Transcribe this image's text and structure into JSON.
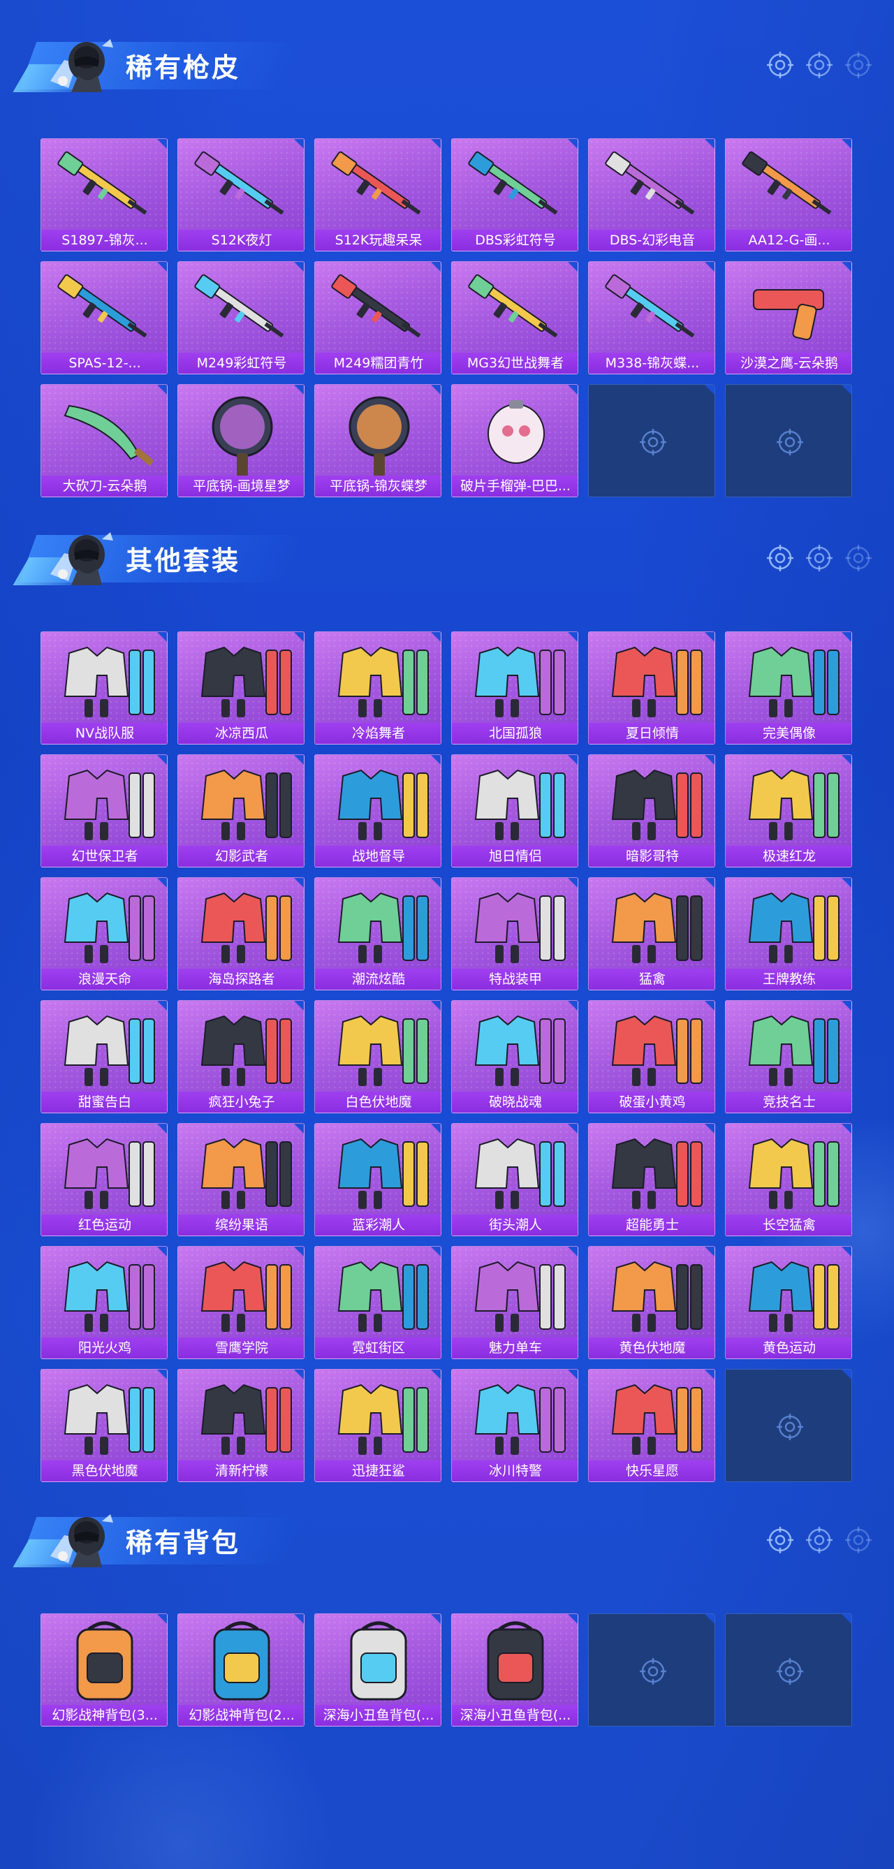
{
  "colors": {
    "background": "#1c4fd8",
    "card_purple": "#a65ae0",
    "label_bar": "#9133e8",
    "empty_slot": "#1e3d7d",
    "title_text": "#ffffff"
  },
  "sections": [
    {
      "title": "稀有枪皮",
      "items": [
        {
          "label": "S1897-锦灰...",
          "icon": "shotgun-icon"
        },
        {
          "label": "S12K夜灯",
          "icon": "shotgun-icon"
        },
        {
          "label": "S12K玩趣呆呆",
          "icon": "shotgun-icon"
        },
        {
          "label": "DBS彩虹符号",
          "icon": "shotgun-icon"
        },
        {
          "label": "DBS-幻彩电音",
          "icon": "shotgun-icon"
        },
        {
          "label": "AA12-G-画...",
          "icon": "rifle-icon"
        },
        {
          "label": "SPAS-12-...",
          "icon": "shotgun-icon"
        },
        {
          "label": "M249彩虹符号",
          "icon": "machine-gun-icon"
        },
        {
          "label": "M249糯团青竹",
          "icon": "machine-gun-icon"
        },
        {
          "label": "MG3幻世战舞者",
          "icon": "machine-gun-icon"
        },
        {
          "label": "M338-锦灰蝶...",
          "icon": "rifle-icon"
        },
        {
          "label": "沙漠之鹰-云朵鹅",
          "icon": "pistol-icon"
        },
        {
          "label": "大砍刀-云朵鹅",
          "icon": "machete-icon"
        },
        {
          "label": "平底锅-画境星梦",
          "icon": "pan-icon"
        },
        {
          "label": "平底锅-锦灰蝶梦",
          "icon": "pan-icon"
        },
        {
          "label": "破片手榴弹-巴巴...",
          "icon": "grenade-icon"
        }
      ],
      "empty_slots": 2
    },
    {
      "title": "其他套装",
      "items": [
        {
          "label": "NV战队服",
          "icon": "outfit-icon"
        },
        {
          "label": "冰凉西瓜",
          "icon": "outfit-icon"
        },
        {
          "label": "冷焰舞者",
          "icon": "outfit-icon"
        },
        {
          "label": "北国孤狼",
          "icon": "outfit-icon"
        },
        {
          "label": "夏日倾情",
          "icon": "outfit-icon"
        },
        {
          "label": "完美偶像",
          "icon": "outfit-icon"
        },
        {
          "label": "幻世保卫者",
          "icon": "outfit-icon"
        },
        {
          "label": "幻影武者",
          "icon": "outfit-icon"
        },
        {
          "label": "战地督导",
          "icon": "outfit-icon"
        },
        {
          "label": "旭日情侣",
          "icon": "outfit-icon"
        },
        {
          "label": "暗影哥特",
          "icon": "outfit-icon"
        },
        {
          "label": "极速红龙",
          "icon": "outfit-icon"
        },
        {
          "label": "浪漫天命",
          "icon": "outfit-icon"
        },
        {
          "label": "海岛探路者",
          "icon": "outfit-icon"
        },
        {
          "label": "潮流炫酷",
          "icon": "outfit-icon"
        },
        {
          "label": "特战装甲",
          "icon": "outfit-icon"
        },
        {
          "label": "猛禽",
          "icon": "outfit-icon"
        },
        {
          "label": "王牌教练",
          "icon": "outfit-icon"
        },
        {
          "label": "甜蜜告白",
          "icon": "outfit-icon"
        },
        {
          "label": "疯狂小兔子",
          "icon": "outfit-icon"
        },
        {
          "label": "白色伏地魔",
          "icon": "outfit-icon"
        },
        {
          "label": "破晓战魂",
          "icon": "outfit-icon"
        },
        {
          "label": "破蛋小黄鸡",
          "icon": "outfit-icon"
        },
        {
          "label": "竞技名士",
          "icon": "outfit-icon"
        },
        {
          "label": "红色运动",
          "icon": "outfit-icon"
        },
        {
          "label": "缤纷果语",
          "icon": "outfit-icon"
        },
        {
          "label": "蓝彩潮人",
          "icon": "outfit-icon"
        },
        {
          "label": "街头潮人",
          "icon": "outfit-icon"
        },
        {
          "label": "超能勇士",
          "icon": "outfit-icon"
        },
        {
          "label": "长空猛禽",
          "icon": "outfit-icon"
        },
        {
          "label": "阳光火鸡",
          "icon": "outfit-icon"
        },
        {
          "label": "雪鹰学院",
          "icon": "outfit-icon"
        },
        {
          "label": "霓虹街区",
          "icon": "outfit-icon"
        },
        {
          "label": "魅力单车",
          "icon": "outfit-icon"
        },
        {
          "label": "黄色伏地魔",
          "icon": "outfit-icon"
        },
        {
          "label": "黄色运动",
          "icon": "outfit-icon"
        },
        {
          "label": "黑色伏地魔",
          "icon": "outfit-icon"
        },
        {
          "label": "清新柠檬",
          "icon": "outfit-icon"
        },
        {
          "label": "迅捷狂鲨",
          "icon": "outfit-icon"
        },
        {
          "label": "冰川特警",
          "icon": "outfit-icon"
        },
        {
          "label": "快乐星愿",
          "icon": "outfit-icon"
        }
      ],
      "empty_slots": 1
    },
    {
      "title": "稀有背包",
      "items": [
        {
          "label": "幻影战神背包(3...",
          "icon": "backpack-icon"
        },
        {
          "label": "幻影战神背包(2...",
          "icon": "backpack-icon"
        },
        {
          "label": "深海小丑鱼背包(...",
          "icon": "backpack-icon"
        },
        {
          "label": "深海小丑鱼背包(...",
          "icon": "backpack-icon"
        }
      ],
      "empty_slots": 2
    }
  ]
}
